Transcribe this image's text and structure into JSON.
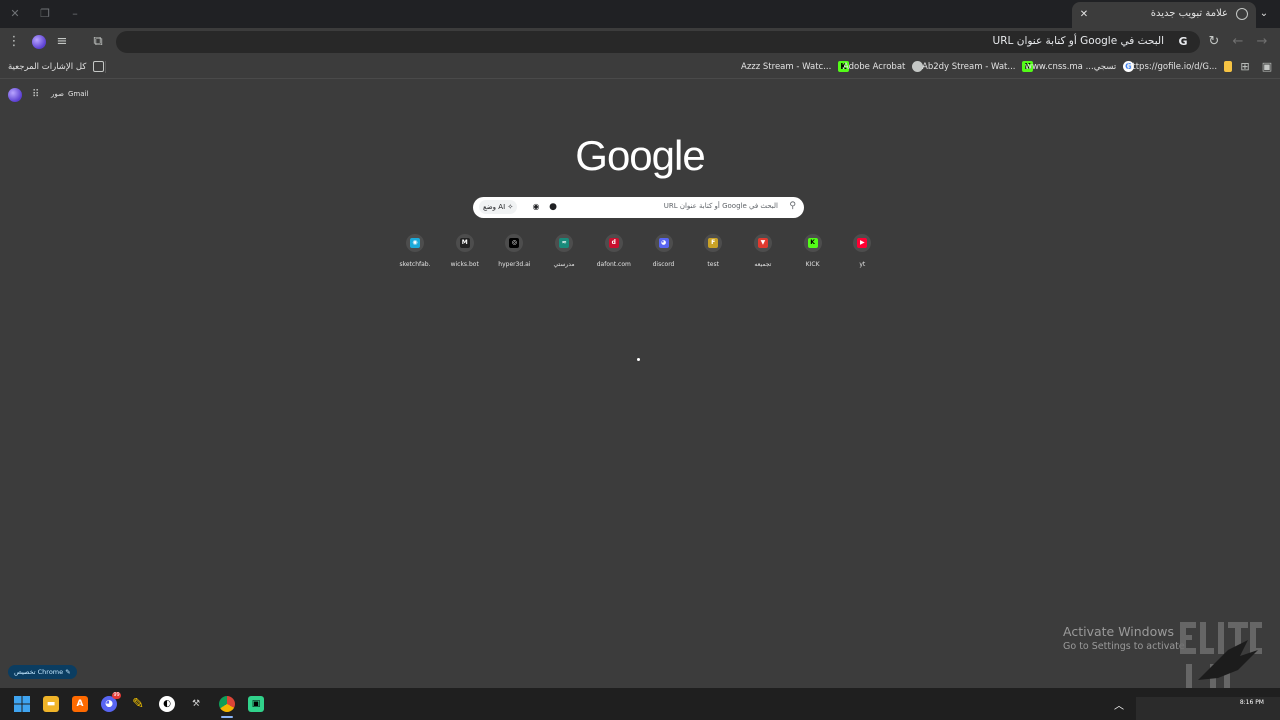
{
  "browser": {
    "tab": {
      "title": "علامة تبويب جديدة"
    },
    "omnibox": {
      "text": "البحث في Google أو كتابة عنوان URL"
    },
    "bookmarks": {
      "all_bookmarks": "كل الإشارات المرجعية",
      "items": [
        {
          "label": "https://gofile.io/d/G...",
          "icon": "file-icon"
        },
        {
          "label": "www.cnss.ma ...تسجي",
          "icon": "google-icon"
        },
        {
          "label": "Ab2dy Stream - Wat...",
          "icon": "kick-icon"
        },
        {
          "label": "Adobe Acrobat",
          "icon": "globe-icon"
        },
        {
          "label": "Azzz Stream - Watc...",
          "icon": "kick-icon"
        }
      ]
    }
  },
  "ntp": {
    "gmail": "Gmail",
    "images": "صور",
    "logo": "Google",
    "search": {
      "placeholder": "البحث في Google أو كتابة عنوان URL",
      "ai_mode": "وضع AI"
    },
    "shortcuts": [
      {
        "label": "sketchfab.",
        "color": "#1caad9",
        "glyph": "◉"
      },
      {
        "label": "wicks.bot",
        "color": "#222222",
        "glyph": "M"
      },
      {
        "label": "hyper3d.ai",
        "color": "#000000",
        "glyph": "◎"
      },
      {
        "label": "مدرستي",
        "color": "#1a8a7a",
        "glyph": "≈"
      },
      {
        "label": "dafont.com",
        "color": "#c8102e",
        "glyph": "d"
      },
      {
        "label": "discord",
        "color": "#5865f2",
        "glyph": "◕"
      },
      {
        "label": "test",
        "color": "#c9a227",
        "glyph": "F"
      },
      {
        "label": "تجميعه",
        "color": "#e03a2f",
        "glyph": "▼"
      },
      {
        "label": "KICK",
        "color": "#53fc18",
        "glyph": "K"
      },
      {
        "label": "yt",
        "color": "#ff0033",
        "glyph": "▶"
      }
    ],
    "customize_label": "تخصيص Chrome"
  },
  "watermark": {
    "title": "Activate Windows",
    "subtitle": "Go to Settings to activate"
  },
  "taskbar": {
    "clock": "8:16 PM",
    "discord_badge": "99",
    "apps": [
      "windows-start-icon",
      "file-explorer-icon",
      "app-a-icon",
      "discord-icon",
      "pen-app-icon",
      "github-icon",
      "tool-icon",
      "chrome-icon",
      "chat-app-icon"
    ]
  }
}
